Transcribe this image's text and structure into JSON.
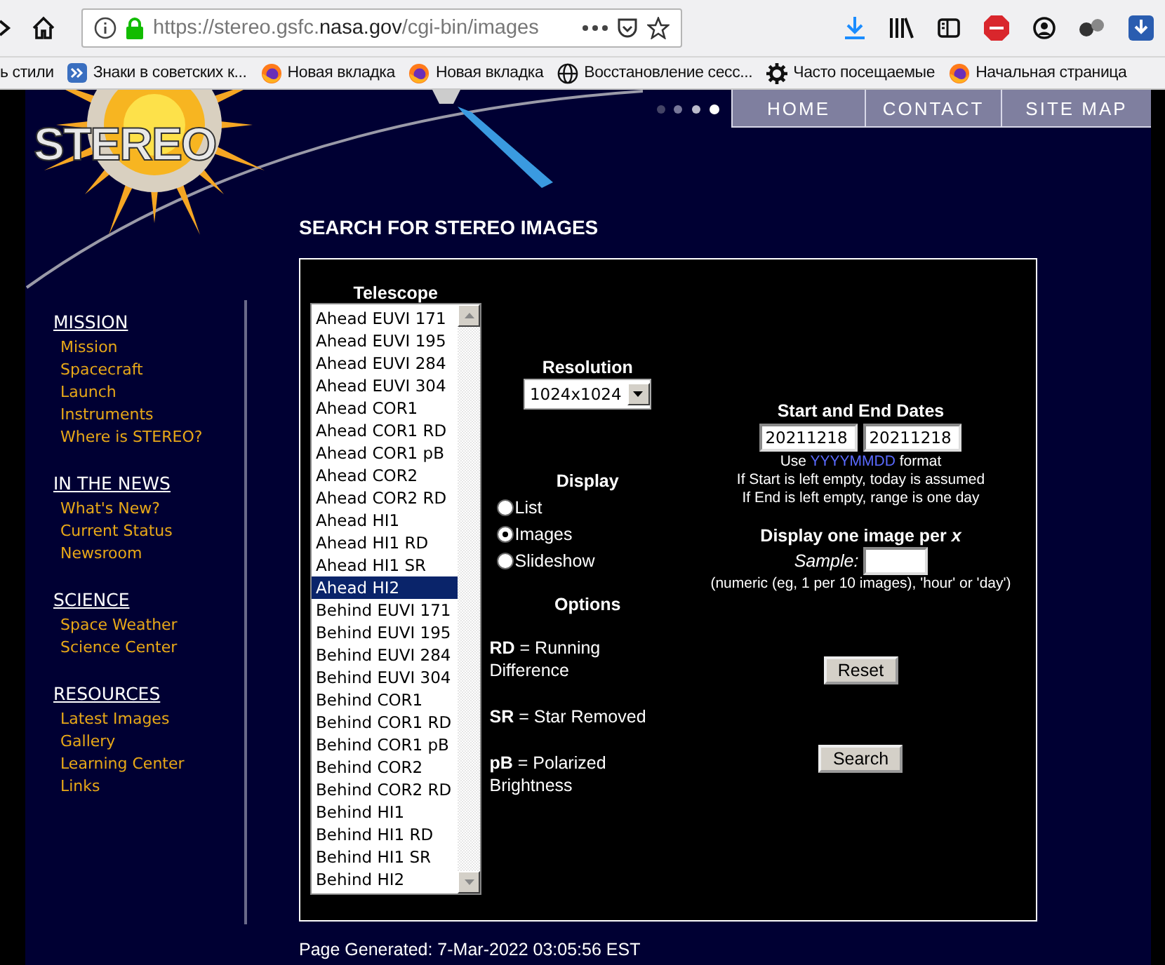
{
  "browser": {
    "url": "https://stereo.gsfc.**nasa.gov**/cgi-bin/images",
    "bookmarks": [
      {
        "label": "ь стили",
        "kind": "none"
      },
      {
        "label": "Знаки в советских к...",
        "kind": "shortcut"
      },
      {
        "label": "Новая вкладка",
        "kind": "firefox"
      },
      {
        "label": "Новая вкладка",
        "kind": "firefox"
      },
      {
        "label": "Восстановление сесс...",
        "kind": "globe"
      },
      {
        "label": "Часто посещаемые",
        "kind": "gear"
      },
      {
        "label": "Начальная страница",
        "kind": "firefox"
      }
    ]
  },
  "site": {
    "logo": "STEREO",
    "nav": [
      "HOME",
      "CONTACT",
      "SITE MAP"
    ],
    "sidebar": [
      {
        "heading": "MISSION",
        "links": [
          "Mission",
          "Spacecraft",
          "Launch",
          "Instruments",
          "Where is STEREO?"
        ]
      },
      {
        "heading": "IN THE NEWS",
        "links": [
          "What's New?",
          "Current Status",
          "Newsroom"
        ]
      },
      {
        "heading": "SCIENCE",
        "links": [
          "Space Weather",
          "Science Center"
        ]
      },
      {
        "heading": "RESOURCES",
        "links": [
          "Latest Images",
          "Gallery",
          "Learning Center",
          "Links"
        ]
      }
    ],
    "title": "SEARCH FOR STEREO IMAGES",
    "footer": "Page Generated: 7-Mar-2022 03:05:56 EST"
  },
  "form": {
    "telescope": {
      "heading": "Telescope",
      "items": [
        {
          "label": "Ahead EUVI 171",
          "selected": false
        },
        {
          "label": "Ahead EUVI 195",
          "selected": false
        },
        {
          "label": "Ahead EUVI 284",
          "selected": false
        },
        {
          "label": "Ahead EUVI 304",
          "selected": false
        },
        {
          "label": "Ahead COR1",
          "selected": false
        },
        {
          "label": "Ahead COR1 RD",
          "selected": false
        },
        {
          "label": "Ahead COR1 pB",
          "selected": false
        },
        {
          "label": "Ahead COR2",
          "selected": false
        },
        {
          "label": "Ahead COR2 RD",
          "selected": false
        },
        {
          "label": "Ahead HI1",
          "selected": false
        },
        {
          "label": "Ahead HI1 RD",
          "selected": false
        },
        {
          "label": "Ahead HI1 SR",
          "selected": false
        },
        {
          "label": "Ahead HI2",
          "selected": true
        },
        {
          "label": "Behind EUVI 171",
          "selected": false
        },
        {
          "label": "Behind EUVI 195",
          "selected": false
        },
        {
          "label": "Behind EUVI 284",
          "selected": false
        },
        {
          "label": "Behind EUVI 304",
          "selected": false
        },
        {
          "label": "Behind COR1",
          "selected": false
        },
        {
          "label": "Behind COR1 RD",
          "selected": false
        },
        {
          "label": "Behind COR1 pB",
          "selected": false
        },
        {
          "label": "Behind COR2",
          "selected": false
        },
        {
          "label": "Behind COR2 RD",
          "selected": false
        },
        {
          "label": "Behind HI1",
          "selected": false
        },
        {
          "label": "Behind HI1 RD",
          "selected": false
        },
        {
          "label": "Behind HI1 SR",
          "selected": false
        },
        {
          "label": "Behind HI2",
          "selected": false
        }
      ]
    },
    "resolution": {
      "heading": "Resolution",
      "value": "1024x1024"
    },
    "display": {
      "heading": "Display",
      "options": [
        {
          "label": "List",
          "selected": false
        },
        {
          "label": "Images",
          "selected": true
        },
        {
          "label": "Slideshow",
          "selected": false
        }
      ]
    },
    "options": {
      "heading": "Options",
      "notes": [
        "**RD** = Running Difference",
        "**SR** = Star Removed",
        "**pB** = Polarized Brightness"
      ]
    },
    "dates": {
      "heading": "Start and End Dates",
      "start": "20211218",
      "end": "20211218",
      "format_hint": {
        "prefix": "Use",
        "code": "YYYYMMDD",
        "suffix": "format"
      },
      "hints": [
        "If Start is left empty, today is assumed",
        "If End is left empty, range is one day"
      ]
    },
    "sampling": {
      "heading": "Display one image per *x*",
      "label": "Sample:",
      "hint": "(numeric (eg, 1 per 10 images), 'hour' or 'day')"
    },
    "buttons": [
      "Reset",
      "Search"
    ]
  }
}
